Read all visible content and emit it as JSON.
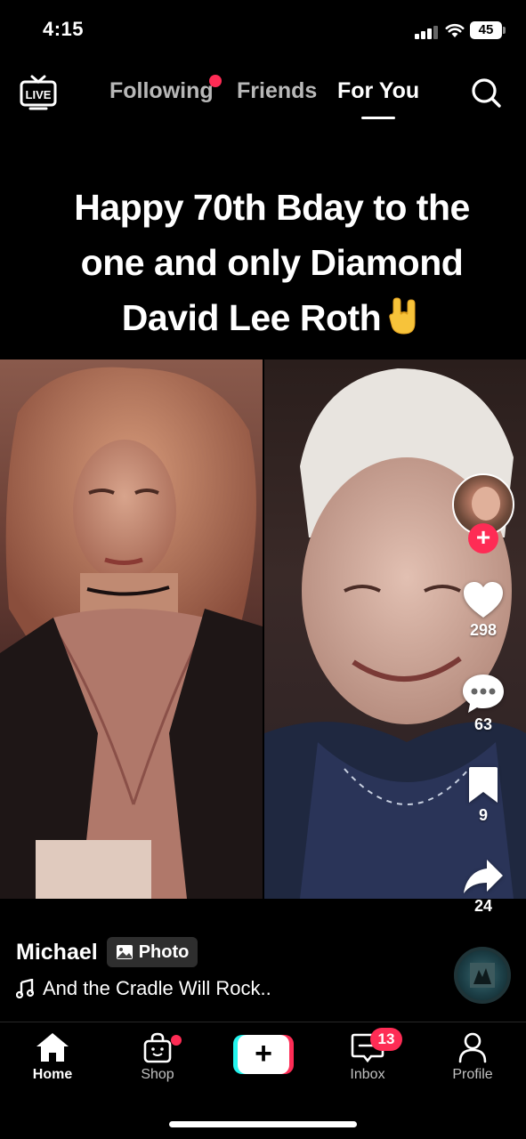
{
  "status_bar": {
    "time": "4:15",
    "battery": "45"
  },
  "top_nav": {
    "live_label": "LIVE",
    "tabs": [
      {
        "label": "Following",
        "has_dot": true
      },
      {
        "label": "Friends"
      },
      {
        "label": "For You",
        "active": true
      }
    ]
  },
  "post": {
    "headline_lines": [
      "Happy 70th Bday to the",
      "one and only Diamond",
      "David Lee Roth"
    ],
    "headline_emoji": "rock-on-hand-emoji",
    "author": "Michael",
    "type_badge": "Photo",
    "music": "And the Cradle Will Rock.."
  },
  "actions": {
    "likes": "298",
    "comments": "63",
    "saves": "9",
    "shares": "24"
  },
  "tab_bar": {
    "home": "Home",
    "shop": "Shop",
    "inbox": "Inbox",
    "inbox_badge": "13",
    "profile": "Profile"
  },
  "colors": {
    "accent": "#fe2c55",
    "cyan": "#25f4ee",
    "background": "#000000"
  }
}
